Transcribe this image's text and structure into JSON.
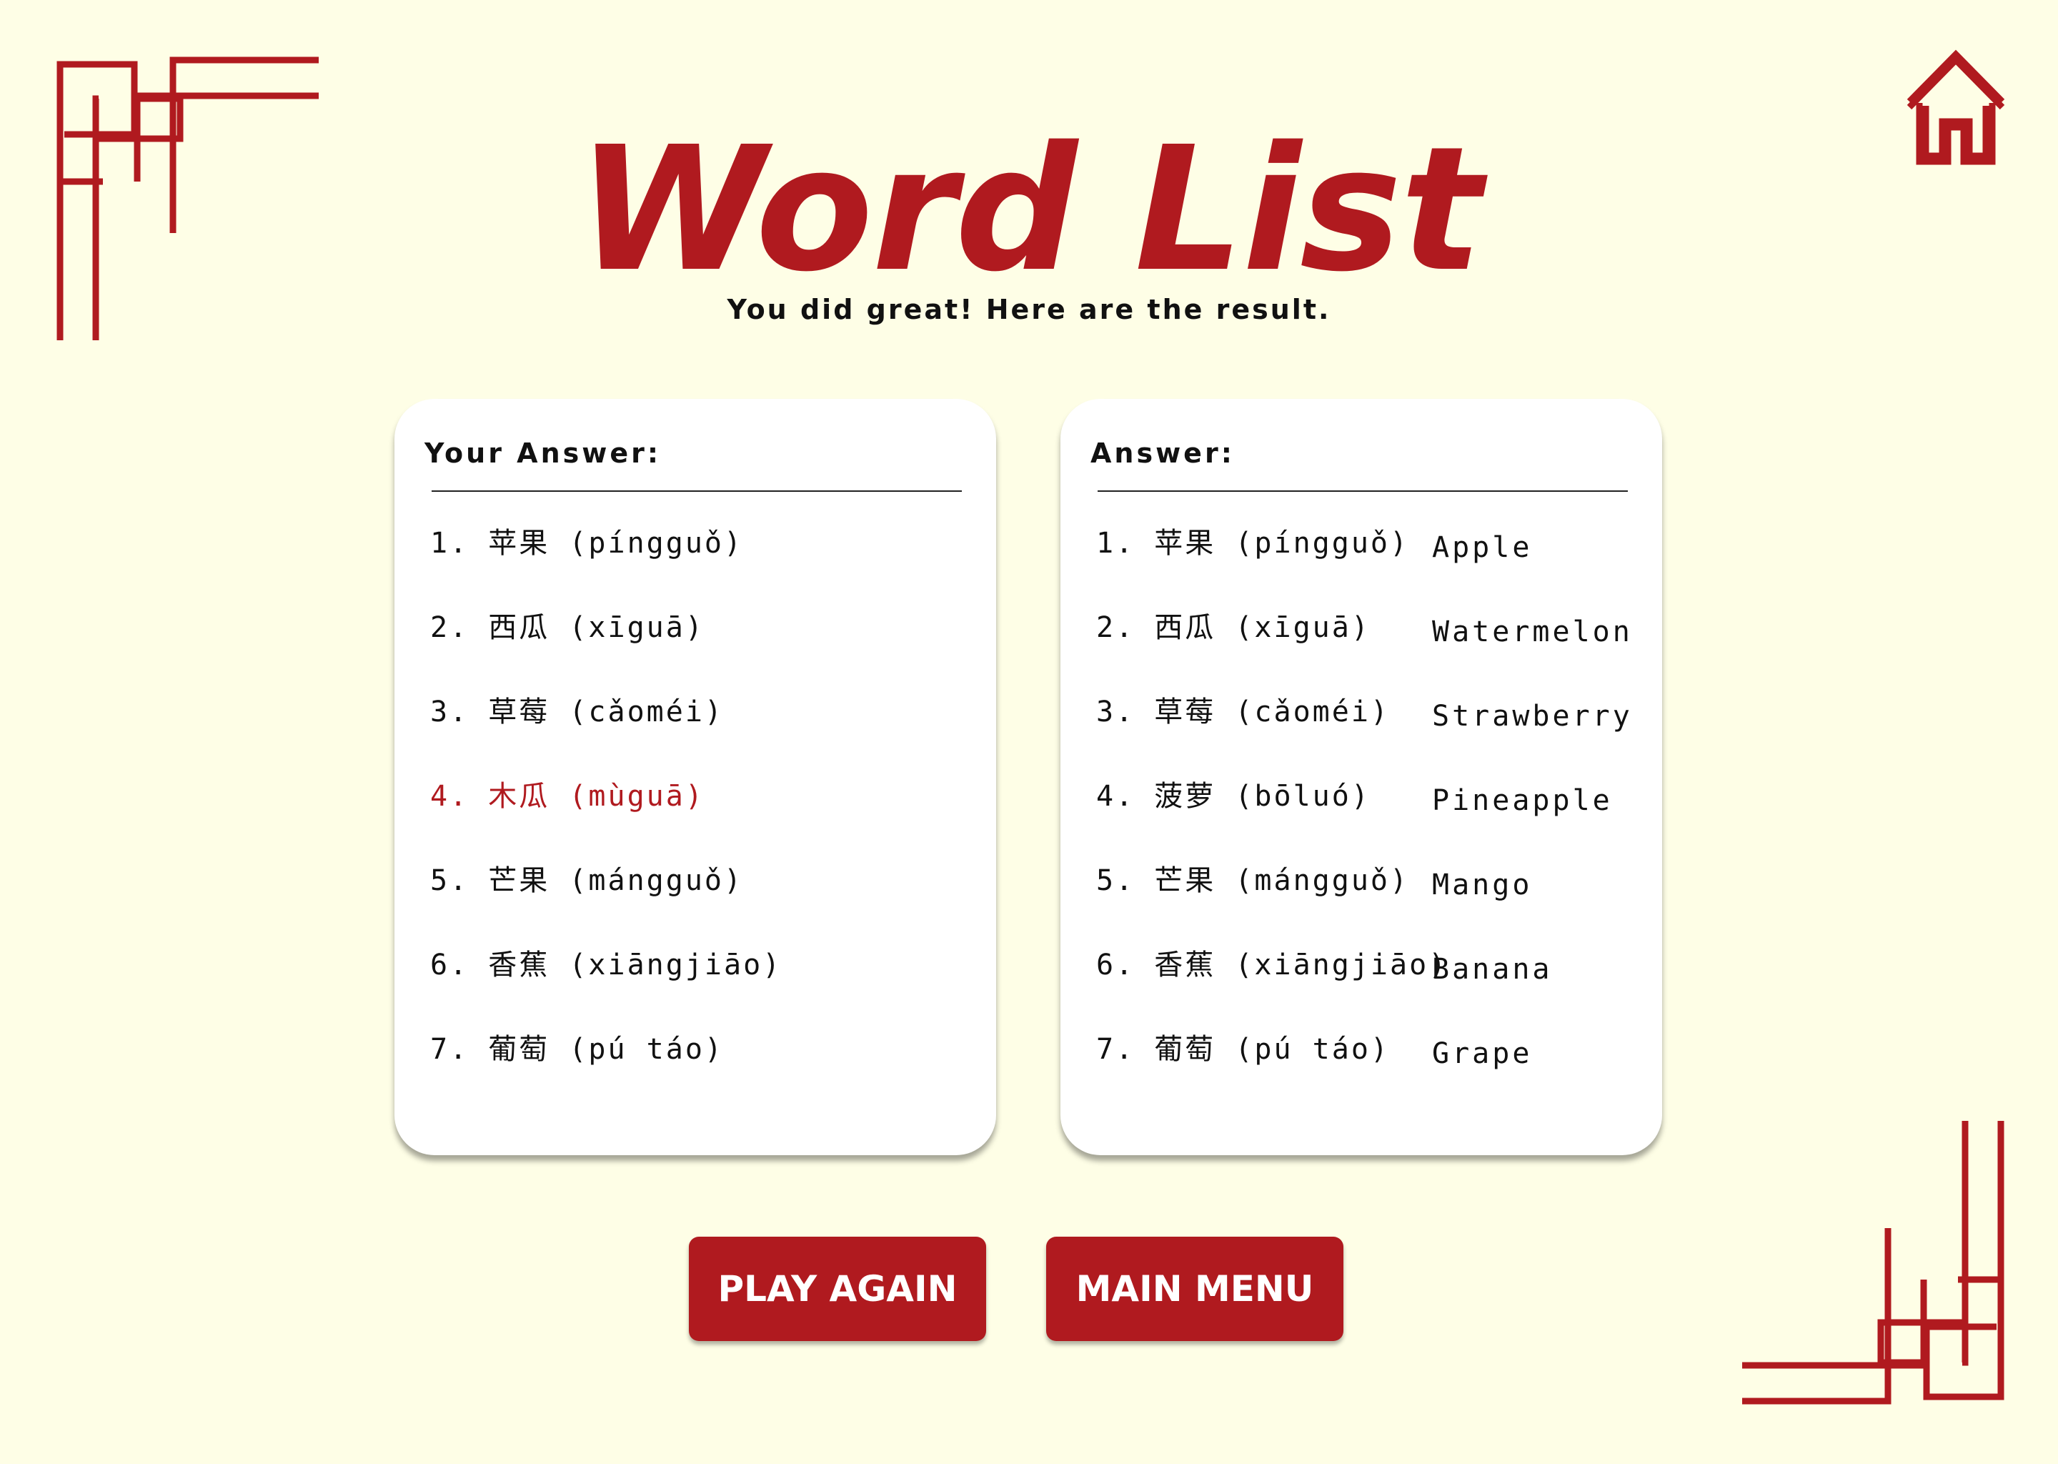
{
  "header": {
    "title": "Word List",
    "subtitle": "You did great! Here are the result."
  },
  "your_answer": {
    "heading": "Your Answer:",
    "items": [
      {
        "text": "1. 苹果 (píngguǒ)",
        "correct": true
      },
      {
        "text": "2. 西瓜 (xīguā)",
        "correct": true
      },
      {
        "text": "3. 草莓 (cǎoméi)",
        "correct": true
      },
      {
        "text": "4. 木瓜 (mùguā)",
        "correct": false
      },
      {
        "text": "5. 芒果 (mángguǒ)",
        "correct": true
      },
      {
        "text": "6. 香蕉 (xiāngjiāo)",
        "correct": true
      },
      {
        "text": "7. 葡萄 (pú táo)",
        "correct": true
      }
    ]
  },
  "answer_key": {
    "heading": "Answer:",
    "items": [
      {
        "text": "1. 苹果 (píngguǒ)",
        "meaning": "Apple"
      },
      {
        "text": "2. 西瓜 (xīguā)",
        "meaning": "Watermelon"
      },
      {
        "text": "3. 草莓 (cǎoméi)",
        "meaning": "Strawberry"
      },
      {
        "text": "4. 菠萝 (bōluó)",
        "meaning": "Pineapple"
      },
      {
        "text": "5. 芒果 (mángguǒ)",
        "meaning": "Mango"
      },
      {
        "text": "6. 香蕉 (xiāngjiāo)",
        "meaning": "Banana"
      },
      {
        "text": "7. 葡萄 (pú táo)",
        "meaning": "Grape"
      }
    ]
  },
  "buttons": {
    "play_again": "PLAY AGAIN",
    "main_menu": "MAIN MENU"
  },
  "icons": {
    "home": "home-icon",
    "corner_top_left": "ornament-corner-icon",
    "corner_bottom_right": "ornament-corner-icon"
  },
  "colors": {
    "background": "#fefee6",
    "accent_red": "#b01a1f",
    "card": "#ffffff",
    "text": "#111111"
  }
}
